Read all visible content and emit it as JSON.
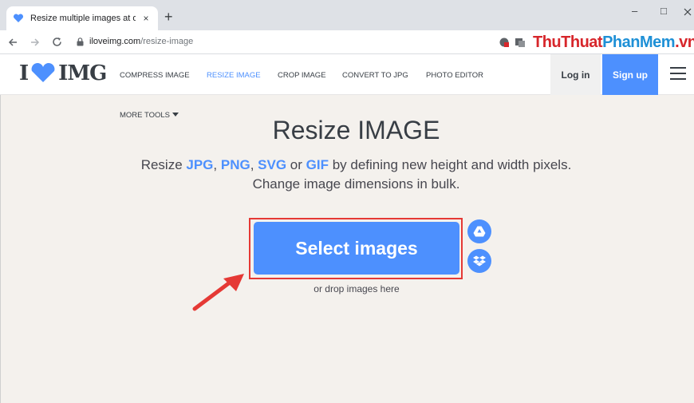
{
  "browser": {
    "tab_title": "Resize multiple images at once!",
    "tab_close": "×",
    "new_tab": "+",
    "minimize": "–",
    "maximize": "□",
    "url_domain": "iloveimg.com",
    "url_path": "/resize-image"
  },
  "watermark": {
    "part1": "ThuThuat",
    "part2": "PhanMem",
    "part3": ".vn"
  },
  "header": {
    "logo_left": "I",
    "logo_right": "IMG",
    "nav": [
      "COMPRESS IMAGE",
      "RESIZE IMAGE",
      "CROP IMAGE",
      "CONVERT TO JPG",
      "PHOTO EDITOR"
    ],
    "login": "Log in",
    "signup": "Sign up"
  },
  "main": {
    "more_tools": "MORE TOOLS",
    "title": "Resize IMAGE",
    "sub_1": "Resize ",
    "fmt_jpg": "JPG",
    "sep_1": ", ",
    "fmt_png": "PNG",
    "sep_2": ", ",
    "fmt_svg": "SVG",
    "sep_3": " or ",
    "fmt_gif": "GIF",
    "sub_2": " by defining new height and width pixels.",
    "sub_line2": "Change image dimensions in bulk.",
    "select_button": "Select images",
    "drop_text": "or drop images here"
  },
  "colors": {
    "accent": "#4d90fe",
    "heart": "#4d90fe",
    "highlight": "#e53935"
  }
}
